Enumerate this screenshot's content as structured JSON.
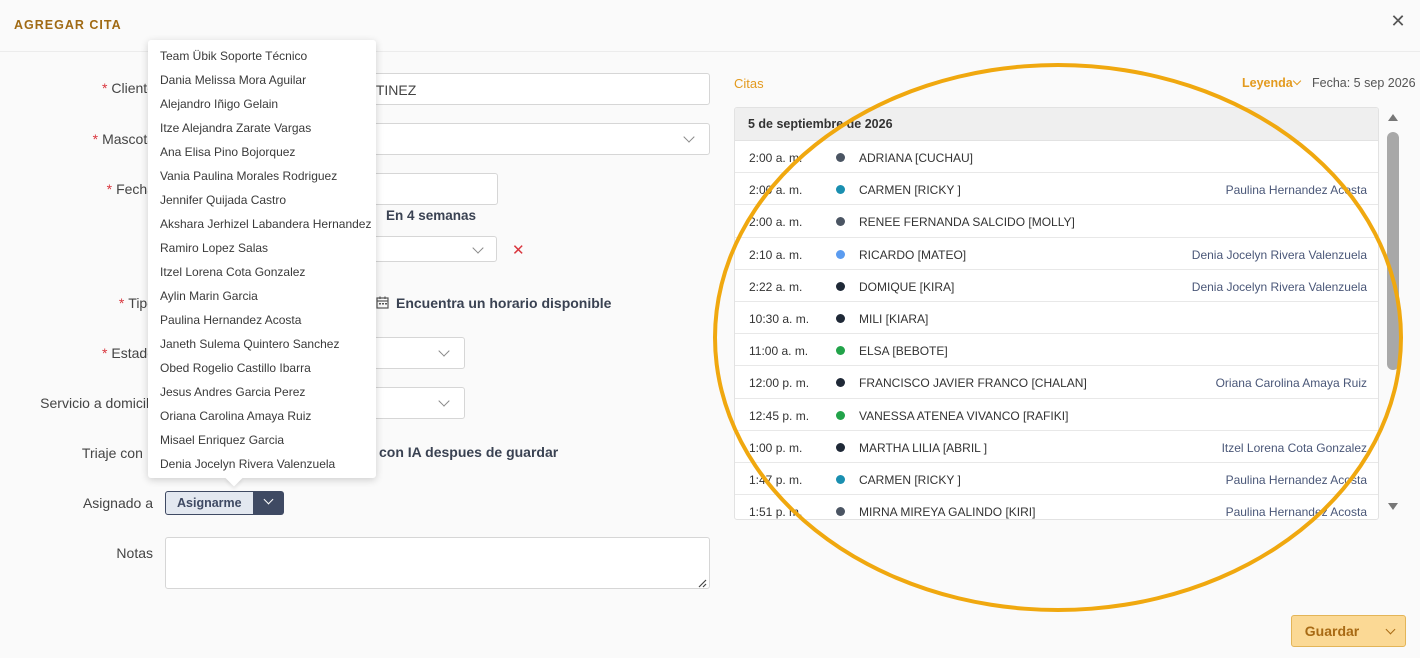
{
  "modal": {
    "title": "AGREGAR CITA",
    "close_glyph": "✕"
  },
  "form": {
    "cliente_label": "Cliente",
    "cliente_value_partial": "RTINEZ",
    "mascota_label": "Mascota",
    "fecha_label": "Fecha",
    "fecha_hint": "En 4 semanas",
    "tipo_label": "Tipo",
    "tipo_link": "Encuentra un horario disponible",
    "estado_label": "Estado",
    "servicio_label": "Servicio a domicilio",
    "triaje_label": "Triaje con IA",
    "triaje_text_partial": "con IA despues de guardar",
    "asignado_label": "Asignado a",
    "asignarme_label": "Asignarme",
    "notas_label": "Notas",
    "required_mark": "*",
    "clear_glyph": "✕"
  },
  "dropdown_options": [
    "Team Übik Soporte Técnico",
    "Dania Melissa Mora Aguilar",
    "Alejandro Iñigo Gelain",
    "Itze Alejandra Zarate Vargas",
    "Ana Elisa Pino Bojorquez",
    "Vania Paulina Morales Rodriguez",
    "Jennifer Quijada Castro",
    "Akshara Jerhizel Labandera Hernandez",
    "Ramiro Lopez Salas",
    "Itzel Lorena Cota Gonzalez",
    "Aylin Marin Garcia",
    "Paulina Hernandez Acosta",
    "Janeth Sulema Quintero Sanchez",
    "Obed Rogelio Castillo Ibarra",
    "Jesus Andres Garcia Perez",
    "Oriana Carolina Amaya Ruiz",
    "Misael Enriquez Garcia",
    "Denia Jocelyn Rivera Valenzuela"
  ],
  "citas": {
    "label": "Citas",
    "leyenda": "Leyenda",
    "fecha": "Fecha: 5 sep 2026",
    "day_header": "5 de septiembre de 2026",
    "rows": [
      {
        "time": "2:00 a. m.",
        "name": "ADRIANA [CUCHAU]",
        "vet": "",
        "color": "#4b5563"
      },
      {
        "time": "2:00 a. m.",
        "name": "CARMEN [RICKY ]",
        "vet": "Paulina Hernandez Acosta",
        "color": "#1a8fb0"
      },
      {
        "time": "2:00 a. m.",
        "name": "RENEE FERNANDA SALCIDO [MOLLY]",
        "vet": "",
        "color": "#4b5563"
      },
      {
        "time": "2:10 a. m.",
        "name": "RICARDO [MATEO]",
        "vet": "Denia Jocelyn Rivera Valenzuela",
        "color": "#5b9cf0"
      },
      {
        "time": "2:22 a. m.",
        "name": "DOMIQUE [KIRA]",
        "vet": "Denia Jocelyn Rivera Valenzuela",
        "color": "#1f2937"
      },
      {
        "time": "10:30 a. m.",
        "name": "MILI [KIARA]",
        "vet": "",
        "color": "#1f2937"
      },
      {
        "time": "11:00 a. m.",
        "name": "ELSA [BEBOTE]",
        "vet": "",
        "color": "#22a34a"
      },
      {
        "time": "12:00 p. m.",
        "name": "FRANCISCO JAVIER FRANCO [CHALAN]",
        "vet": "Oriana Carolina Amaya Ruiz",
        "color": "#1f2937"
      },
      {
        "time": "12:45 p. m.",
        "name": "VANESSA ATENEA VIVANCO [RAFIKI]",
        "vet": "",
        "color": "#22a34a"
      },
      {
        "time": "1:00 p. m.",
        "name": "MARTHA LILIA [ABRIL ]",
        "vet": "Itzel Lorena Cota Gonzalez",
        "color": "#1f2937"
      },
      {
        "time": "1:47 p. m.",
        "name": "CARMEN [RICKY ]",
        "vet": "Paulina Hernandez Acosta",
        "color": "#1a8fb0"
      },
      {
        "time": "1:51 p. m.",
        "name": "MIRNA MIREYA GALINDO [KIRI]",
        "vet": "Paulina Hernandez Acosta",
        "color": "#4b5563"
      }
    ]
  },
  "footer": {
    "guardar": "Guardar"
  },
  "colors": {
    "accent": "#e39a1e",
    "annotation_ring": "#f0a80f",
    "primary_dark": "#3f4a63",
    "required": "#d9363e"
  },
  "icons": {
    "calendar": "calendar-icon",
    "close": "close-icon",
    "chevron": "chevron-down-icon"
  }
}
